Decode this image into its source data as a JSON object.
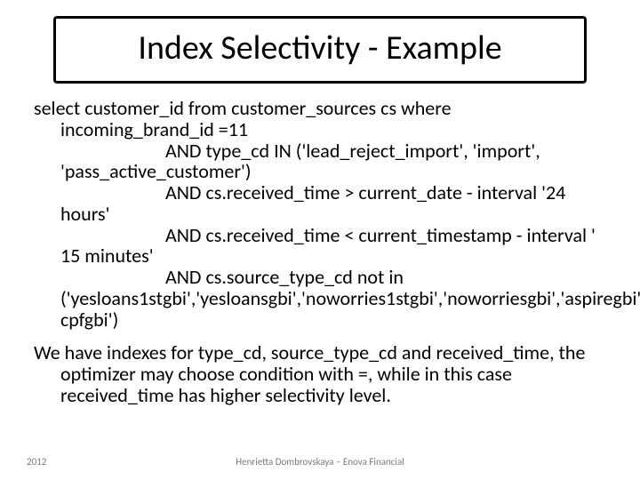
{
  "title": "Index Selectivity - Example",
  "sql": {
    "line1": "select customer_id  from customer_sources  cs where incoming_brand_id =11",
    "clause1": "AND type_cd IN ('lead_reject_import', 'import', 'pass_active_customer')",
    "clause2": "AND cs.received_time > current_date - interval '24 hours'",
    "clause3": "AND cs.received_time < current_timestamp - interval ' 15 minutes'",
    "clause4": "AND cs.source_type_cd not in ('yesloans1stgbi','yesloansgbi','noworries1stgbi','noworriesgbi','aspiregbi','aspire-cpfgbi')"
  },
  "explain": "We have indexes for type_cd, source_type_cd and received_time, the optimizer may choose condition with =, while in this case received_time has higher selectivity level.",
  "footer": {
    "year": "2012",
    "author": "Henrietta Dombrovskaya – Enova Financial"
  }
}
